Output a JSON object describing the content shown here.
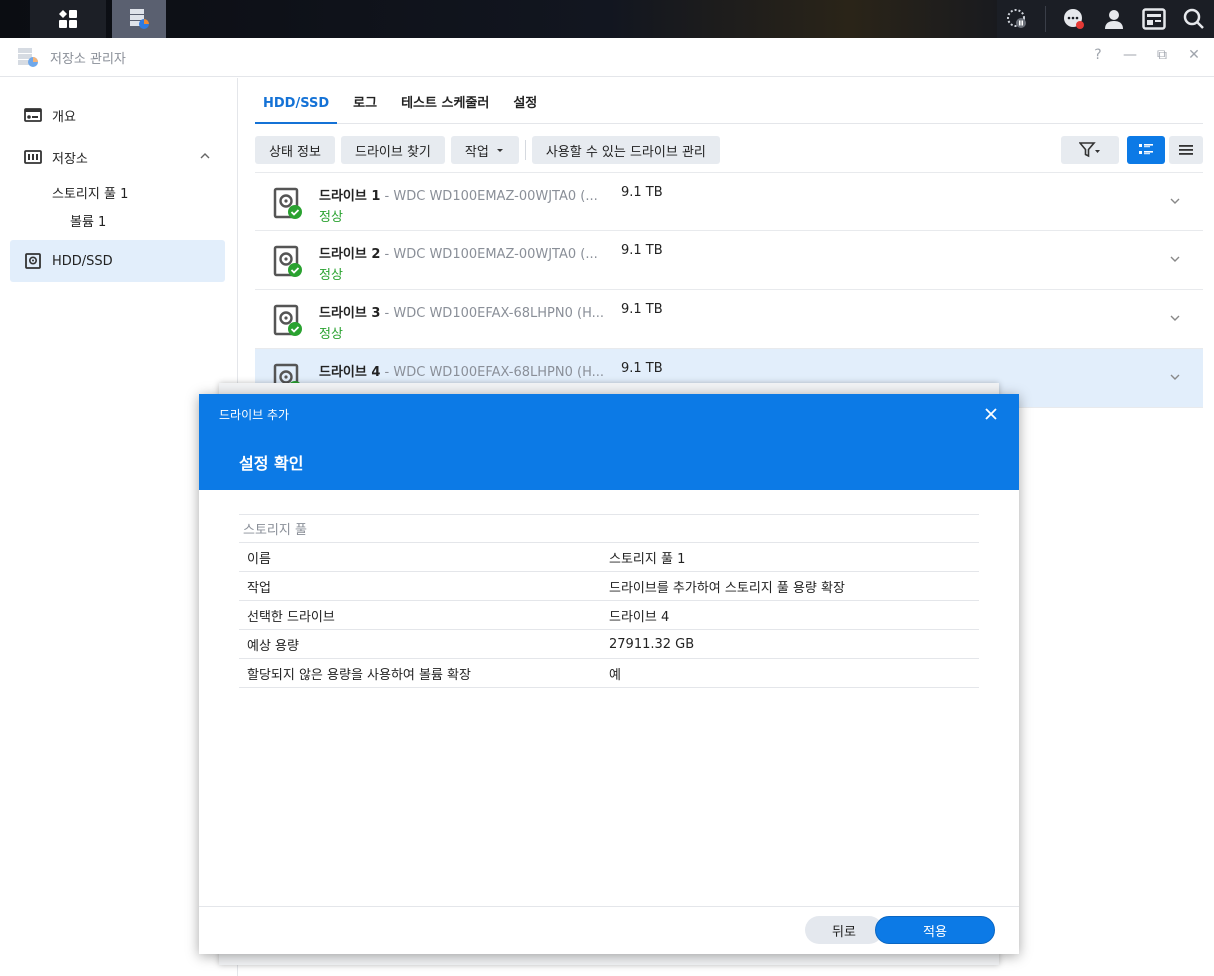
{
  "colors": {
    "accent": "#0c7ae6",
    "tab_active": "#1472d6",
    "status_ok": "#2aa230",
    "selected_bg": "#e2eefb"
  },
  "taskbar": {
    "icons": [
      "dashboard-icon",
      "storage-manager-icon",
      "resource-monitor-icon",
      "chat-icon",
      "user-icon",
      "widgets-icon",
      "search-icon"
    ]
  },
  "window": {
    "title": "저장소 관리자",
    "help": "?",
    "minimize": "—",
    "restore": "⧉",
    "close": "✕"
  },
  "sidebar": {
    "items": [
      {
        "label": "개요"
      },
      {
        "label": "저장소"
      },
      {
        "label": "스토리지 풀 1"
      },
      {
        "label": "볼륨 1"
      },
      {
        "label": "HDD/SSD"
      }
    ]
  },
  "tabs": [
    "HDD/SSD",
    "로그",
    "테스트 스케줄러",
    "설정"
  ],
  "toolbar": {
    "status_info": "상태 정보",
    "find_drive": "드라이브 찾기",
    "action": "작업",
    "manage_available": "사용할 수 있는 드라이브 관리"
  },
  "drives": [
    {
      "name": "드라이브 1",
      "model": " - WDC WD100EMAZ-00WJTA0 (...",
      "size": "9.1 TB",
      "status": "정상"
    },
    {
      "name": "드라이브 2",
      "model": " - WDC WD100EMAZ-00WJTA0 (...",
      "size": "9.1 TB",
      "status": "정상"
    },
    {
      "name": "드라이브 3",
      "model": " - WDC WD100EFAX-68LHPN0 (H...",
      "size": "9.1 TB",
      "status": "정상"
    },
    {
      "name": "드라이브 4",
      "model": " - WDC WD100EFAX-68LHPN0 (H...",
      "size": "9.1 TB",
      "status": ""
    }
  ],
  "dialog": {
    "small_title": "드라이브 추가",
    "big_title": "설정 확인",
    "section": "스토리지 풀",
    "rows": [
      {
        "key": "이름",
        "value": "스토리지 풀 1"
      },
      {
        "key": "작업",
        "value": "드라이브를 추가하여 스토리지 풀 용량 확장"
      },
      {
        "key": "선택한 드라이브",
        "value": "드라이브 4"
      },
      {
        "key": "예상 용량",
        "value": "27911.32 GB"
      },
      {
        "key": "할당되지 않은 용량을 사용하여 볼륨 확장",
        "value": "예"
      }
    ],
    "back": "뒤로",
    "apply": "적용"
  }
}
